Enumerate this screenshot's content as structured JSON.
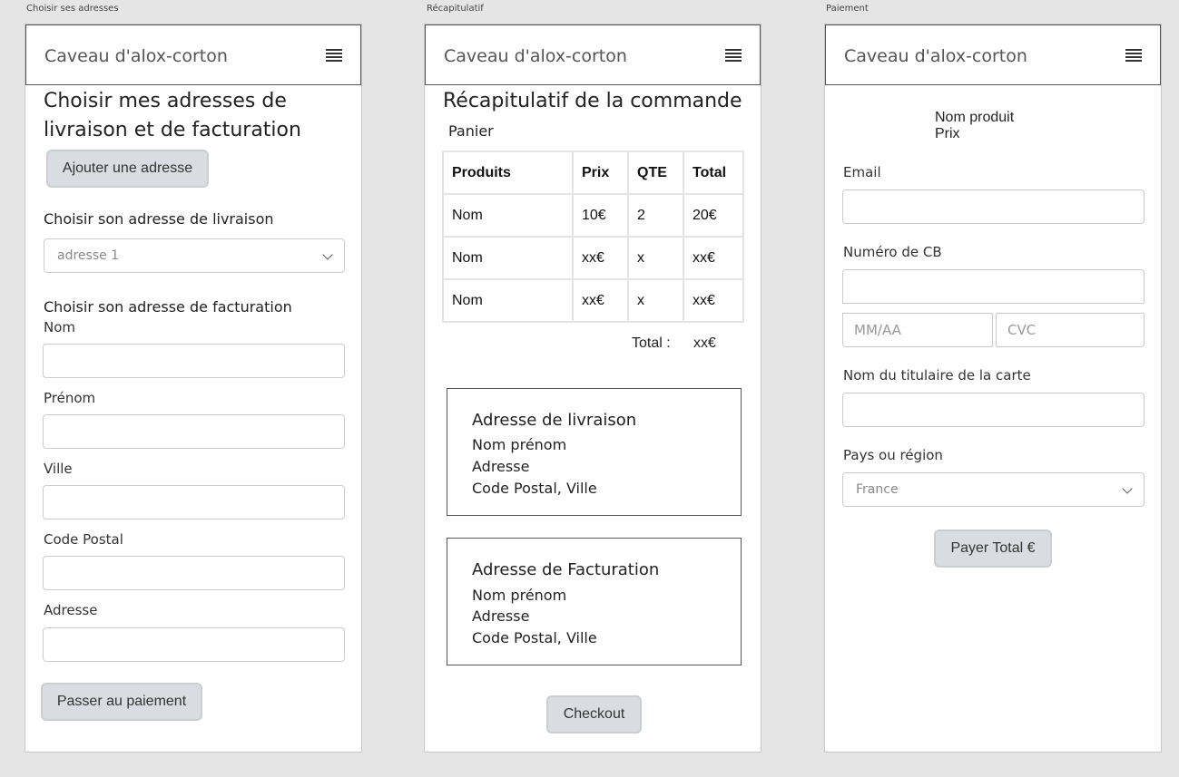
{
  "frames": {
    "addresses_label": "Choisir ses adresses",
    "summary_label": "Récapitulatif",
    "payment_label": "Paiement"
  },
  "header": {
    "title": "Caveau d'alox-corton"
  },
  "addresses": {
    "heading_line1": "Choisir mes adresses de",
    "heading_line2": "livraison et de facturation",
    "add_button": "Ajouter une adresse",
    "delivery_label": "Choisir son adresse de livraison",
    "delivery_selected": "adresse 1",
    "billing_label": "Choisir son adresse de facturation",
    "field_nom": "Nom",
    "field_prenom": "Prénom",
    "field_ville": "Ville",
    "field_code_postal": "Code Postal",
    "field_adresse": "Adresse",
    "submit_button": "Passer au paiement"
  },
  "summary": {
    "heading": "Récapitulatif de la commande",
    "cart_label": "Panier",
    "columns": [
      "Produits",
      "Prix",
      "QTE",
      "Total"
    ],
    "rows": [
      [
        "Nom",
        "10€",
        "2",
        "20€"
      ],
      [
        "Nom",
        "xx€",
        "x",
        "xx€"
      ],
      [
        "Nom",
        "xx€",
        "x",
        "xx€"
      ]
    ],
    "total_label": "Total :",
    "total_value": "xx€",
    "delivery_box": {
      "title": "Adresse de livraison",
      "line1": "Nom prénom",
      "line2": "Adresse",
      "line3": "Code Postal, Ville"
    },
    "billing_box": {
      "title": "Adresse de Facturation",
      "line1": "Nom prénom",
      "line2": "Adresse",
      "line3": "Code Postal, Ville"
    },
    "checkout_button": "Checkout"
  },
  "payment": {
    "product_name": "Nom produit",
    "product_price": "Prix",
    "email_label": "Email",
    "card_label": "Numéro de CB",
    "expiry_placeholder": "MM/AA",
    "cvc_placeholder": "CVC",
    "holder_label": "Nom du titulaire de la carte",
    "country_label": "Pays ou région",
    "country_selected": "France",
    "pay_button": "Payer Total €"
  }
}
